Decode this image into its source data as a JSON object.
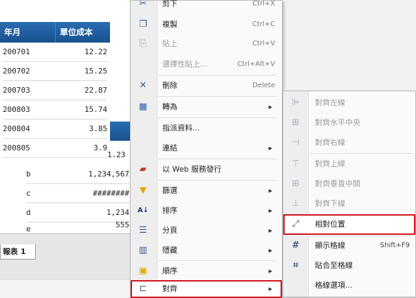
{
  "table": {
    "headers": [
      "年月",
      "單位成本"
    ],
    "rows": [
      [
        "200701",
        "12.22"
      ],
      [
        "200702",
        "15.25"
      ],
      [
        "200703",
        "22.87"
      ],
      [
        "200803",
        "15.74"
      ],
      [
        "200804",
        "3.85"
      ],
      [
        "200805",
        "3.9"
      ]
    ],
    "overflow_fragment": "1.23"
  },
  "table2": {
    "rows": [
      [
        "b",
        "1,234,567"
      ],
      [
        "c",
        "########"
      ],
      [
        "d",
        "1,234"
      ],
      [
        "e",
        "555"
      ]
    ]
  },
  "sheet_tab": "報表 1",
  "menu": {
    "items": [
      {
        "label": "剪下",
        "shortcut": "Ctrl+X",
        "icon": "scissors-icon",
        "glyph": "✂"
      },
      {
        "label": "複製",
        "shortcut": "Ctrl+C",
        "icon": "copy-icon",
        "glyph": "❐"
      },
      {
        "label": "貼上",
        "shortcut": "Ctrl+V",
        "icon": "paste-icon",
        "glyph": "📋"
      },
      {
        "label": "選擇性貼上...",
        "shortcut": "Ctrl+Alt+V",
        "icon": "",
        "glyph": ""
      },
      {
        "label": "刪除",
        "shortcut": "Delete",
        "icon": "delete-x-icon",
        "glyph": "✕"
      },
      {
        "label": "轉為",
        "shortcut": "",
        "icon": "convert-table-icon",
        "glyph": "▦"
      },
      {
        "label": "指派資料...",
        "shortcut": "",
        "icon": "",
        "glyph": ""
      },
      {
        "label": "連結",
        "shortcut": "",
        "icon": "",
        "glyph": ""
      },
      {
        "label": "以 Web 服務發行",
        "shortcut": "",
        "icon": "web-service-icon",
        "glyph": "▰"
      },
      {
        "label": "篩選",
        "shortcut": "",
        "icon": "filter-icon",
        "glyph": "▼"
      },
      {
        "label": "排序",
        "shortcut": "",
        "icon": "sort-az-icon",
        "glyph": "A↓"
      },
      {
        "label": "分頁",
        "shortcut": "",
        "icon": "page-break-icon",
        "glyph": "☰"
      },
      {
        "label": "隱藏",
        "shortcut": "",
        "icon": "hide-columns-icon",
        "glyph": "▥"
      },
      {
        "label": "順序",
        "shortcut": "",
        "icon": "order-icon",
        "glyph": "▣"
      },
      {
        "label": "對齊",
        "shortcut": "",
        "icon": "align-icon",
        "glyph": "⊏"
      }
    ]
  },
  "submenu": {
    "items": [
      {
        "label": "對齊左線",
        "shortcut": "",
        "icon": "align-left-icon",
        "glyph": "⊫"
      },
      {
        "label": "對齊水平中央",
        "shortcut": "",
        "icon": "align-center-h-icon",
        "glyph": "⊞"
      },
      {
        "label": "對齊右線",
        "shortcut": "",
        "icon": "align-right-icon",
        "glyph": "⊣"
      },
      {
        "label": "對齊上線",
        "shortcut": "",
        "icon": "align-top-icon",
        "glyph": "⊤"
      },
      {
        "label": "對齊垂直中間",
        "shortcut": "",
        "icon": "align-middle-v-icon",
        "glyph": "⊞"
      },
      {
        "label": "對齊下線",
        "shortcut": "",
        "icon": "align-bottom-icon",
        "glyph": "⊥"
      },
      {
        "label": "相對位置",
        "shortcut": "",
        "icon": "relative-position-icon",
        "glyph": "⤢"
      },
      {
        "label": "顯示格線",
        "shortcut": "Shift+F9",
        "icon": "grid-icon",
        "glyph": "#"
      },
      {
        "label": "貼合至格線",
        "shortcut": "",
        "icon": "snap-to-grid-icon",
        "glyph": "⌗"
      },
      {
        "label": "格線選項...",
        "shortcut": "",
        "icon": "",
        "glyph": ""
      }
    ]
  },
  "colors": {
    "header_blue": "#1f5fa5",
    "highlight_red": "#d0121b"
  }
}
